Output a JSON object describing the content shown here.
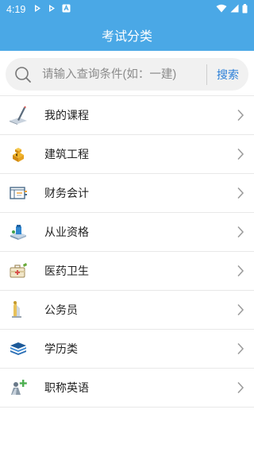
{
  "status_bar": {
    "time": "4:19"
  },
  "app_bar": {
    "title": "考试分类"
  },
  "search": {
    "placeholder": "请输入查询条件(如：一建)",
    "button_label": "搜索"
  },
  "categories": [
    {
      "label": "我的课程",
      "icon": "pen-book-icon"
    },
    {
      "label": "建筑工程",
      "icon": "building-blocks-icon"
    },
    {
      "label": "财务会计",
      "icon": "ledger-icon"
    },
    {
      "label": "从业资格",
      "icon": "certificate-icon"
    },
    {
      "label": "医药卫生",
      "icon": "medical-kit-icon"
    },
    {
      "label": "公务员",
      "icon": "civil-servant-icon"
    },
    {
      "label": "学历类",
      "icon": "layers-icon"
    },
    {
      "label": "职称英语",
      "icon": "person-plus-icon"
    }
  ],
  "colors": {
    "primary": "#4aa8e6",
    "link": "#2b7fd8",
    "search_bg": "#f1f1f1"
  }
}
